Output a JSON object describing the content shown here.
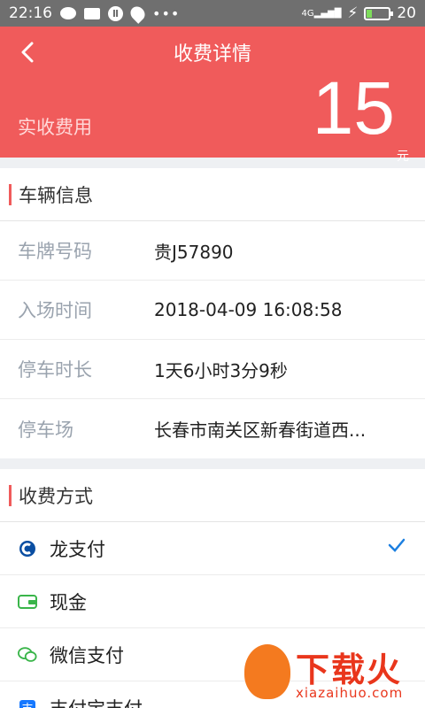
{
  "status_bar": {
    "time": "22:16",
    "network": "4G",
    "battery": "20",
    "battery_level": 0.2,
    "icons": [
      "chat-bubble-icon",
      "mail-icon",
      "app-icon",
      "location-icon",
      "more-dots-icon",
      "signal-icon",
      "charging-icon",
      "battery-icon"
    ]
  },
  "header": {
    "back_icon": "chevron-left-icon",
    "title": "收费详情",
    "fee_label": "实收费用",
    "fee_amount": "15",
    "fee_unit": "元",
    "color": "#f05b5b"
  },
  "vehicle_section": {
    "title": "车辆信息",
    "rows": [
      {
        "label": "车牌号码",
        "value": "贵J57890"
      },
      {
        "label": "入场时间",
        "value": "2018-04-09 16:08:58"
      },
      {
        "label": "停车时长",
        "value": "1天6小时3分9秒"
      },
      {
        "label": "停车场",
        "value": "长春市南关区新春街道西..."
      }
    ]
  },
  "payment_section": {
    "title": "收费方式",
    "methods": [
      {
        "label": "龙支付",
        "icon": "ccb-icon",
        "selected": true
      },
      {
        "label": "现金",
        "icon": "wallet-icon",
        "selected": false
      },
      {
        "label": "微信支付",
        "icon": "wechat-icon",
        "selected": false
      },
      {
        "label": "支付宝支付",
        "icon": "alipay-icon",
        "selected": false
      }
    ]
  },
  "watermark": {
    "title": "下载火",
    "url": "xiazaihuo.com"
  }
}
